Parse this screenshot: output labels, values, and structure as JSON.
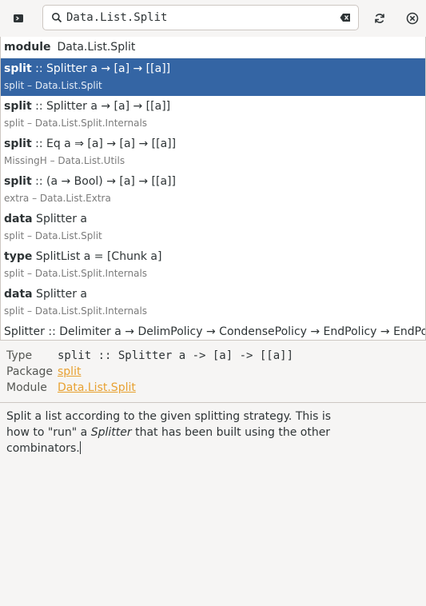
{
  "search": {
    "value": "Data.List.Split",
    "placeholder": ""
  },
  "module_row": {
    "keyword": "module",
    "name": "Data.List.Split"
  },
  "results": [
    {
      "keyword": "split",
      "sig": " :: Splitter a → [a] → [[a]]",
      "source": "split – Data.List.Split",
      "selected": true
    },
    {
      "keyword": "split",
      "sig": " :: Splitter a → [a] → [[a]]",
      "source": "split – Data.List.Split.Internals"
    },
    {
      "keyword": "split",
      "sig": " :: Eq a ⇒ [a] → [a] → [[a]]",
      "source": "MissingH – Data.List.Utils"
    },
    {
      "keyword": "split",
      "sig": " :: (a → Bool) → [a] → [[a]]",
      "source": "extra – Data.List.Extra"
    },
    {
      "keyword": "data",
      "sig": " Splitter a",
      "source": "split – Data.List.Split"
    },
    {
      "keyword": "type",
      "sig": " SplitList a = [Chunk a]",
      "source": "split – Data.List.Split.Internals"
    },
    {
      "keyword": "data",
      "sig": " Splitter a",
      "source": "split – Data.List.Split.Internals"
    }
  ],
  "last_row": "Splitter :: Delimiter a → DelimPolicy → CondensePolicy → EndPolicy → EndPolicy → Splitter a",
  "details": {
    "type_label": "Type",
    "type_value": "split :: Splitter a -> [a] -> [[a]]",
    "package_label": "Package",
    "package_value": "split",
    "module_label": "Module",
    "module_value": "Data.List.Split"
  },
  "doc": {
    "part1": "Split a list according to the given splitting strategy. This is how to \"run\" a ",
    "em": "Splitter",
    "part2": " that has been built using the other combinators."
  },
  "colors": {
    "selection": "#3465a4",
    "link": "#e8a131"
  },
  "icons": {
    "left": "terminal-icon",
    "search": "search-icon",
    "clear": "clear-text-icon",
    "refresh": "refresh-icon",
    "close": "close-icon"
  }
}
